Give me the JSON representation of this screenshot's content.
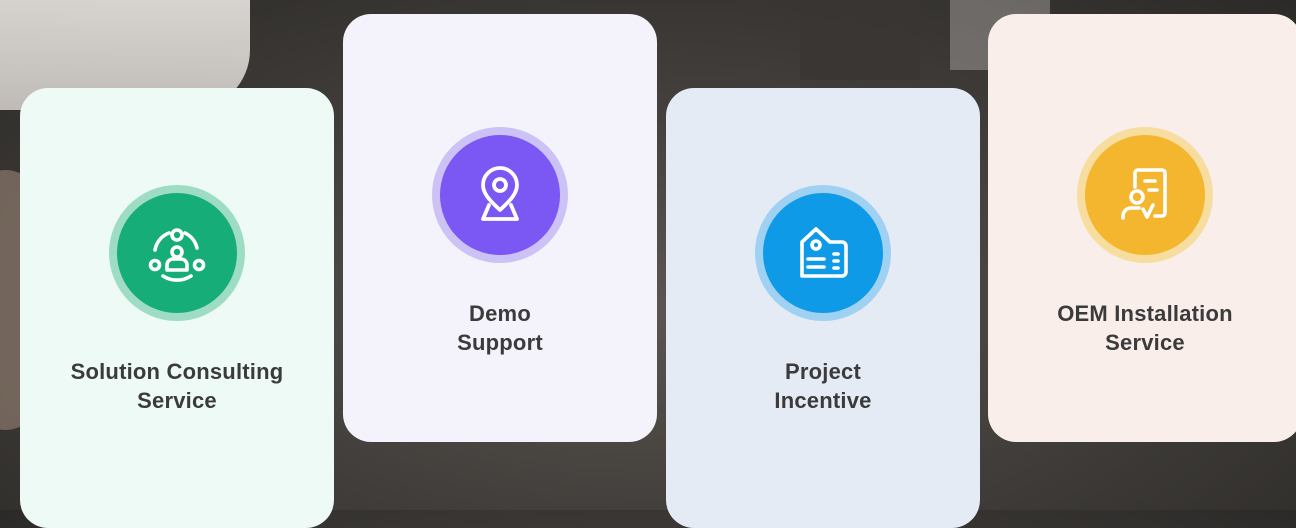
{
  "cards": [
    {
      "label": "Solution Consulting\nService",
      "icon": "consulting-network-icon",
      "bg": "#eefaf5",
      "ring": "#9fdcc4",
      "disc": "#16ad79"
    },
    {
      "label": "Demo\nSupport",
      "icon": "location-pin-icon",
      "bg": "#f4f2fb",
      "ring": "#cdc2f6",
      "disc": "#7b57f3"
    },
    {
      "label": "Project\nIncentive",
      "icon": "id-badge-icon",
      "bg": "#e4ebf5",
      "ring": "#9fd1f2",
      "disc": "#0f9ae8"
    },
    {
      "label": "OEM Installation\nService",
      "icon": "user-document-icon",
      "bg": "#f9eeea",
      "ring": "#f8dda0",
      "disc": "#f4b62e"
    }
  ]
}
